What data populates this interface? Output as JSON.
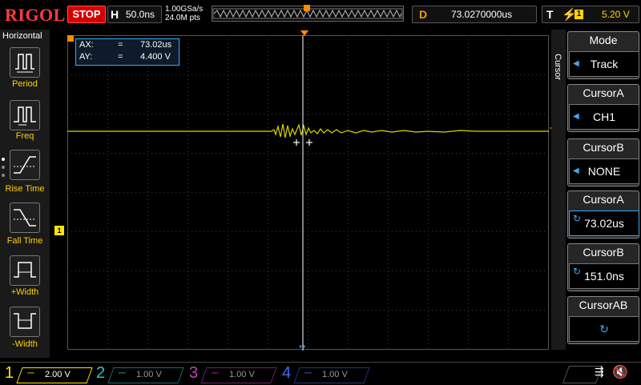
{
  "brand": "RIGOL",
  "run_state": "STOP",
  "horizontal": {
    "label": "H",
    "timebase": "50.0ns"
  },
  "sampling": {
    "rate": "1.00GSa/s",
    "points": "24.0M pts"
  },
  "delay": {
    "label": "D",
    "value": "73.0270000us"
  },
  "trigger": {
    "label": "T",
    "source": "1",
    "level": "5.20 V"
  },
  "left_menu": {
    "title": "Horizontal",
    "items": [
      {
        "label": "Period"
      },
      {
        "label": "Freq"
      },
      {
        "label": "Rise Time"
      },
      {
        "label": "Fall Time"
      },
      {
        "label": "+Width"
      },
      {
        "label": "-Width"
      }
    ]
  },
  "measure": {
    "ax_label": "AX:",
    "ax_value": "73.02us",
    "ay_label": "AY:",
    "ay_value": "4.400 V",
    "eq": "="
  },
  "ch1_marker": "1",
  "right_menu": {
    "tab": "Cursor",
    "items": [
      {
        "title": "Mode",
        "value": "Track"
      },
      {
        "title": "CursorA",
        "value": "CH1"
      },
      {
        "title": "CursorB",
        "value": "NONE"
      },
      {
        "title": "CursorA",
        "value": "73.02us"
      },
      {
        "title": "CursorB",
        "value": "151.0ns"
      },
      {
        "title": "CursorAB",
        "value": ""
      }
    ]
  },
  "channels": [
    {
      "num": "1",
      "scale": "2.00 V",
      "color": "#ffe600"
    },
    {
      "num": "2",
      "scale": "1.00 V",
      "color": "#2ec4c4"
    },
    {
      "num": "3",
      "scale": "1.00 V",
      "color": "#c040c0"
    },
    {
      "num": "4",
      "scale": "1.00 V",
      "color": "#3f6fff"
    }
  ],
  "colors": {
    "trace": "#d8d400",
    "grid": "#3a3a3a",
    "accent": "#3fa9f5",
    "stop": "#d40000"
  }
}
